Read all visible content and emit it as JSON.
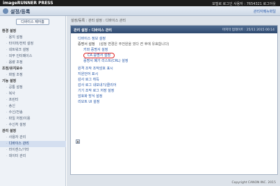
{
  "topbar": {
    "brand": "imageRUNNER PRESS",
    "right_text": "포털로 로그인 사용자 : 7654321 로그아웃"
  },
  "titlebar": {
    "title": "설정/등록",
    "right_link": "관리자메뉴화일"
  },
  "sidebar": {
    "dashboard_button": "디바이스 제어홈",
    "groups": [
      {
        "heading": "환경 설정",
        "items": [
          "용지 설정",
          "타이머/전력 설정",
          "네트워크 설정",
          "외부 인터페이스",
          "음량 조정"
        ]
      },
      {
        "heading": "조정/유지보수",
        "items": [
          "화질 조정"
        ]
      },
      {
        "heading": "기능 설정",
        "items": [
          "공통 설정",
          "복사",
          "프린터",
          "송신",
          "수신/전송",
          "파일 저장/이용"
        ]
      },
      {
        "heading": "",
        "items": [
          "수신처 설정"
        ]
      },
      {
        "heading": "관리 설정",
        "items": [
          "사용자 관리",
          "디바이스 관리",
          "라이센스/기타",
          "데이터 관리"
        ]
      }
    ],
    "active_item": "디바이스 관리"
  },
  "main": {
    "breadcrumb": "설정/등록 : 관리 설정 : 디바이스 관리",
    "panel_title": "관리 설정 : 디바이스 관리",
    "timestamp": "마지막 업데이트 : 25/11 2015 00:14",
    "links": [
      {
        "level": 1,
        "text": "디바이스 정보 설정"
      },
      {
        "level": 1,
        "text": "증명서 설정",
        "note": "(설정 변경은 주전원을 껐다 켠 후에 유효합니다)",
        "plain": true
      },
      {
        "level": 2,
        "text": "키와 증명서 설정"
      },
      {
        "level": 2,
        "text": "CA 증명서 설정",
        "highlight": true
      },
      {
        "level": 2,
        "text": "증명서 폐기 리스트(CRL) 설정"
      },
      {
        "level": 1,
        "text": "",
        "spacer": true
      },
      {
        "level": 1,
        "text": "원격 조작 조작암호 표시"
      },
      {
        "level": 1,
        "text": "지원언어 표시"
      },
      {
        "level": 1,
        "text": "감사 로그 취득"
      },
      {
        "level": 1,
        "text": "감사 로그 내보내기/클리어"
      },
      {
        "level": 1,
        "text": "기기 조작 로그 저장 설정"
      },
      {
        "level": 1,
        "text": "암호화 방식 설정"
      },
      {
        "level": 1,
        "text": "리모트 UI 설정"
      }
    ],
    "top_button": "▲",
    "footer_copyright": "Copyright CANON INC. 2015"
  },
  "colors": {
    "accent": "#2456a8",
    "panel_header": "#3d5a82",
    "highlight_ring": "#e02424"
  }
}
